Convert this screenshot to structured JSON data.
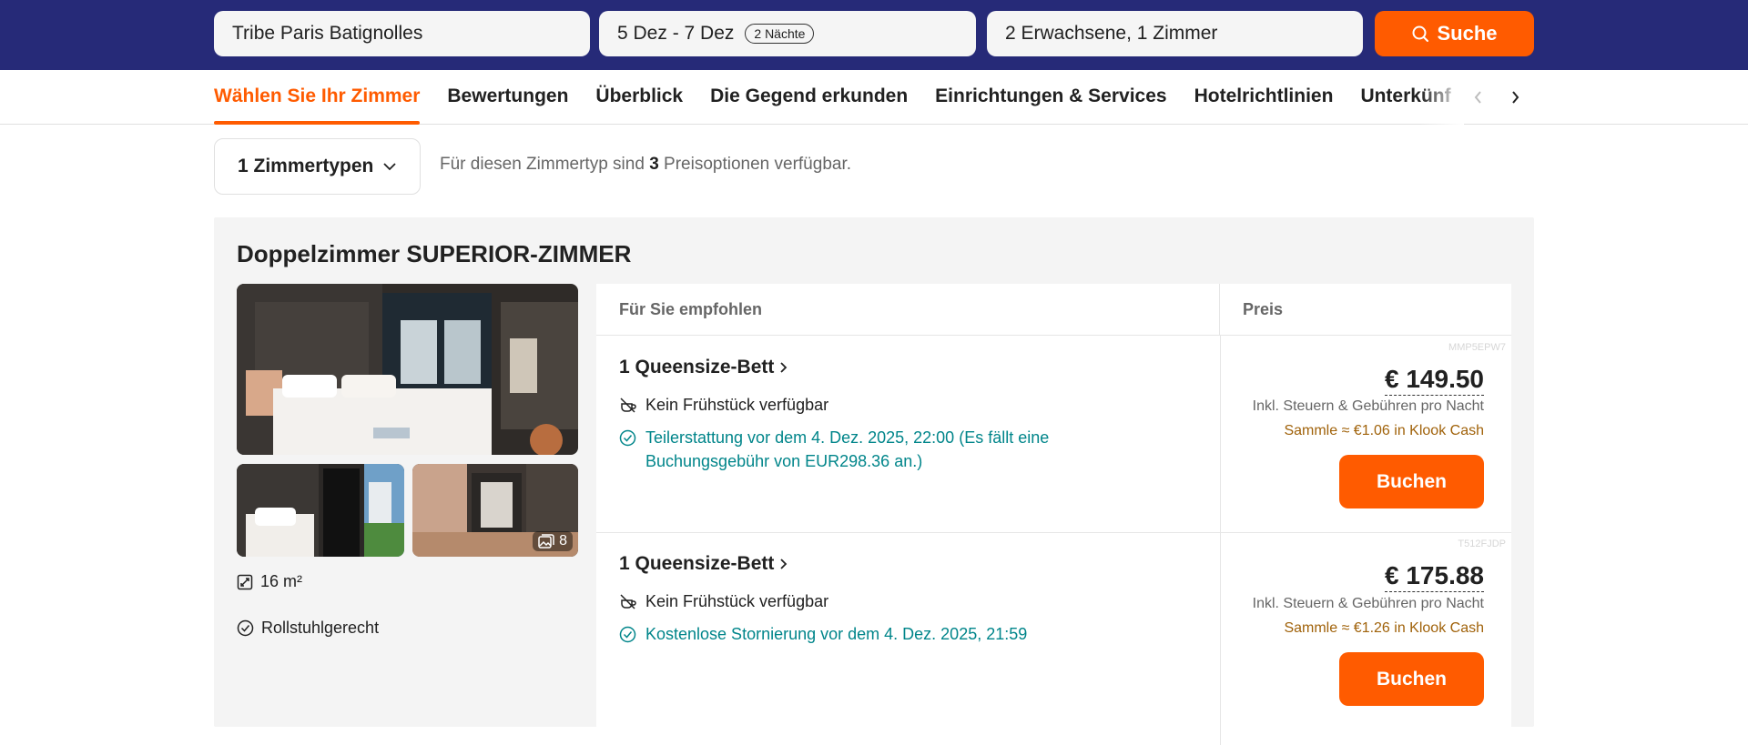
{
  "search": {
    "hotel": "Tribe Paris Batignolles",
    "dates": "5 Dez - 7 Dez",
    "nights": "2 Nächte",
    "guests": "2 Erwachsene, 1 Zimmer",
    "search_label": "Suche"
  },
  "tabs": [
    {
      "label": "Wählen Sie Ihr Zimmer",
      "active": true
    },
    {
      "label": "Bewertungen"
    },
    {
      "label": "Überblick"
    },
    {
      "label": "Die Gegend erkunden"
    },
    {
      "label": "Einrichtungen & Services"
    },
    {
      "label": "Hotelrichtlinien"
    },
    {
      "label": "Unterkünf"
    }
  ],
  "room_types": {
    "select_label": "1 Zimmertypen",
    "info_prefix": "Für diesen Zimmertyp sind ",
    "info_count": "3",
    "info_suffix": " Preisoptionen verfügbar."
  },
  "room": {
    "title": "Doppelzimmer SUPERIOR-ZIMMER",
    "photo_count": "8",
    "size": "16 m²",
    "accessibility": "Rollstuhlgerecht",
    "table_header_recommended": "Für Sie empfohlen",
    "table_header_price": "Preis",
    "options": [
      {
        "code": "MMP5EPW7",
        "bed": "1 Queensize-Bett",
        "breakfast": "Kein Frühstück verfügbar",
        "policy": "Teilerstattung vor dem 4. Dez. 2025, 22:00 (Es fällt eine Buchungsgebühr von EUR298.36 an.)",
        "policy_line1": "Teilerstattung vor dem 4. Dez. 2025, 22:00 (Es fällt eine",
        "policy_line2": "Buchungsgebühr von EUR298.36 an.)",
        "price": "€ 149.50",
        "price_note": "Inkl. Steuern & Gebühren pro Nacht",
        "cash": "Sammle ≈ €1.06 in Klook Cash",
        "book_label": "Buchen"
      },
      {
        "code": "T512FJDP",
        "bed": "1 Queensize-Bett",
        "breakfast": "Kein Frühstück verfügbar",
        "policy": "Kostenlose Stornierung vor dem 4. Dez. 2025, 21:59",
        "price": "€ 175.88",
        "price_note": "Inkl. Steuern & Gebühren pro Nacht",
        "cash": "Sammle ≈ €1.26 in Klook Cash",
        "book_label": "Buchen"
      }
    ]
  },
  "colors": {
    "header_bg": "#262a78",
    "accent": "#ff5b00",
    "policy_green": "#00858a",
    "cash_gold": "#a0620a"
  }
}
